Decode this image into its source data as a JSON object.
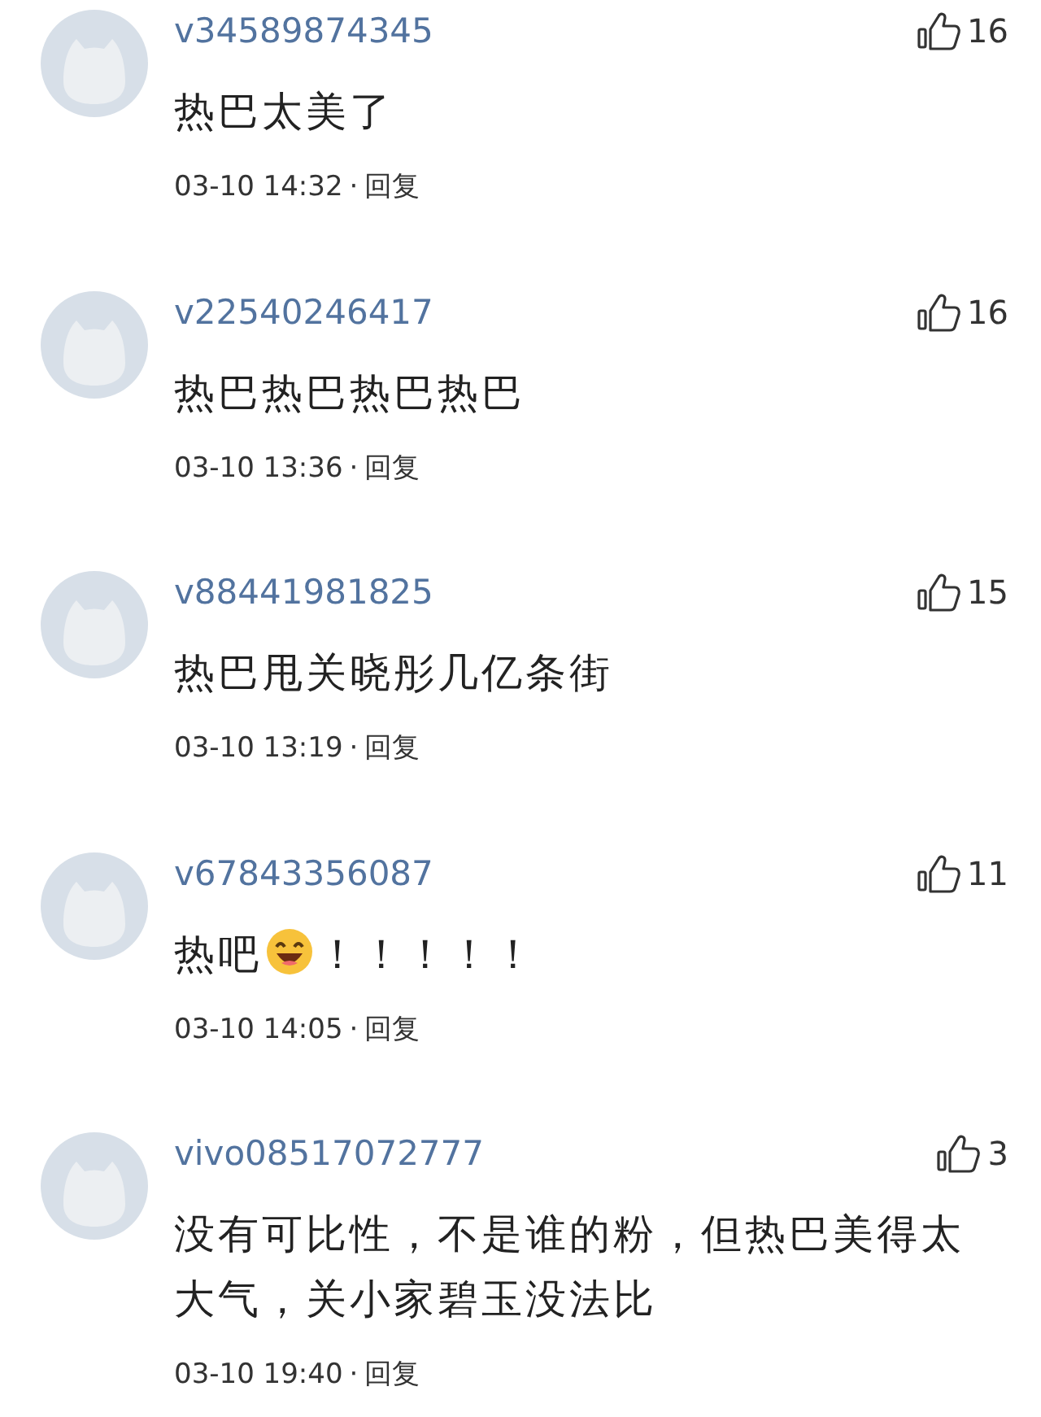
{
  "comments": [
    {
      "user": "v34589874345",
      "likes": "16",
      "content": [
        {
          "kind": "text",
          "text": "热巴太美了"
        }
      ],
      "time": "03-10 14:32",
      "dot": "·",
      "reply": "回复"
    },
    {
      "user": "v22540246417",
      "likes": "16",
      "content": [
        {
          "kind": "text",
          "text": "热巴热巴热巴热巴"
        }
      ],
      "time": "03-10 13:36",
      "dot": "·",
      "reply": "回复"
    },
    {
      "user": "v88441981825",
      "likes": "15",
      "content": [
        {
          "kind": "text",
          "text": "热巴甩关晓彤几亿条街"
        }
      ],
      "time": "03-10 13:19",
      "dot": "·",
      "reply": "回复"
    },
    {
      "user": "v67843356087",
      "likes": "11",
      "content": [
        {
          "kind": "text",
          "text": "热吧"
        },
        {
          "kind": "emoji"
        },
        {
          "kind": "text",
          "text": "！！！！！"
        }
      ],
      "time": "03-10 14:05",
      "dot": "·",
      "reply": "回复"
    },
    {
      "user": "vivo08517072777",
      "likes": "3",
      "content": [
        {
          "kind": "text",
          "text": "没有可比性，不是谁的粉，但热巴美得太大气，关小家碧玉没法比"
        }
      ],
      "time": "03-10 19:40",
      "dot": "·",
      "reply": "回复"
    }
  ]
}
